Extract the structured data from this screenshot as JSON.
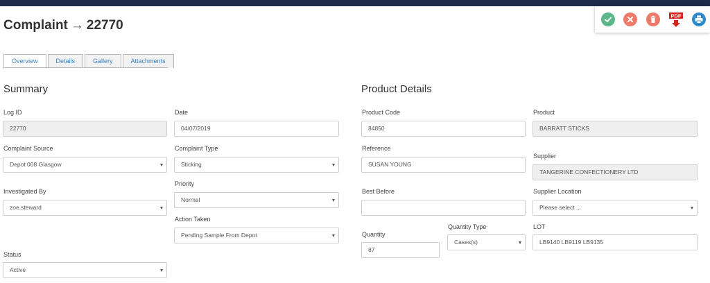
{
  "header": {
    "record_type": "Complaint",
    "arrow": "→",
    "record_id": "22770"
  },
  "actions": {
    "approve_icon": "check-icon",
    "reject_icon": "close-icon",
    "delete_icon": "trash-icon",
    "pdf_label": "PDF",
    "print_icon": "printer-icon",
    "colors": {
      "approve": "#5cb88a",
      "reject": "#ee7b68",
      "delete": "#ee7b68",
      "pdf": "#d9261c",
      "print": "#2e8bc9"
    }
  },
  "tabs": [
    {
      "label": "Overview",
      "active": true
    },
    {
      "label": "Details",
      "active": false
    },
    {
      "label": "Gallery",
      "active": false
    },
    {
      "label": "Attachments",
      "active": false
    }
  ],
  "summary": {
    "title": "Summary",
    "log_id": {
      "label": "Log ID",
      "value": "22770"
    },
    "date": {
      "label": "Date",
      "value": "04/07/2019"
    },
    "complaint_source": {
      "label": "Complaint Source",
      "value": "Depot 008 Glasgow"
    },
    "complaint_type": {
      "label": "Complaint Type",
      "value": "Sticking"
    },
    "priority": {
      "label": "Priority",
      "value": "Normal"
    },
    "investigated_by": {
      "label": "Investigated By",
      "value": "zoe.steward"
    },
    "action_taken": {
      "label": "Action Taken",
      "value": "Pending Sample From Depot"
    },
    "status": {
      "label": "Status",
      "value": "Active"
    }
  },
  "product": {
    "title": "Product Details",
    "product_code": {
      "label": "Product Code",
      "value": "84850"
    },
    "product": {
      "label": "Product",
      "value": "BARRATT STICKS"
    },
    "reference": {
      "label": "Reference",
      "value": "SUSAN YOUNG"
    },
    "supplier": {
      "label": "Supplier",
      "value": "TANGERINE CONFECTIONERY LTD"
    },
    "best_before": {
      "label": "Best Before",
      "value": ""
    },
    "supplier_location": {
      "label": "Supplier Location",
      "placeholder": "Please select ..."
    },
    "quantity": {
      "label": "Quantity",
      "value": "87"
    },
    "quantity_type": {
      "label": "Quantity Type",
      "value": "Cases(s)"
    },
    "lot": {
      "label": "LOT",
      "value": "LB9140 LB9119 LB9135"
    }
  }
}
